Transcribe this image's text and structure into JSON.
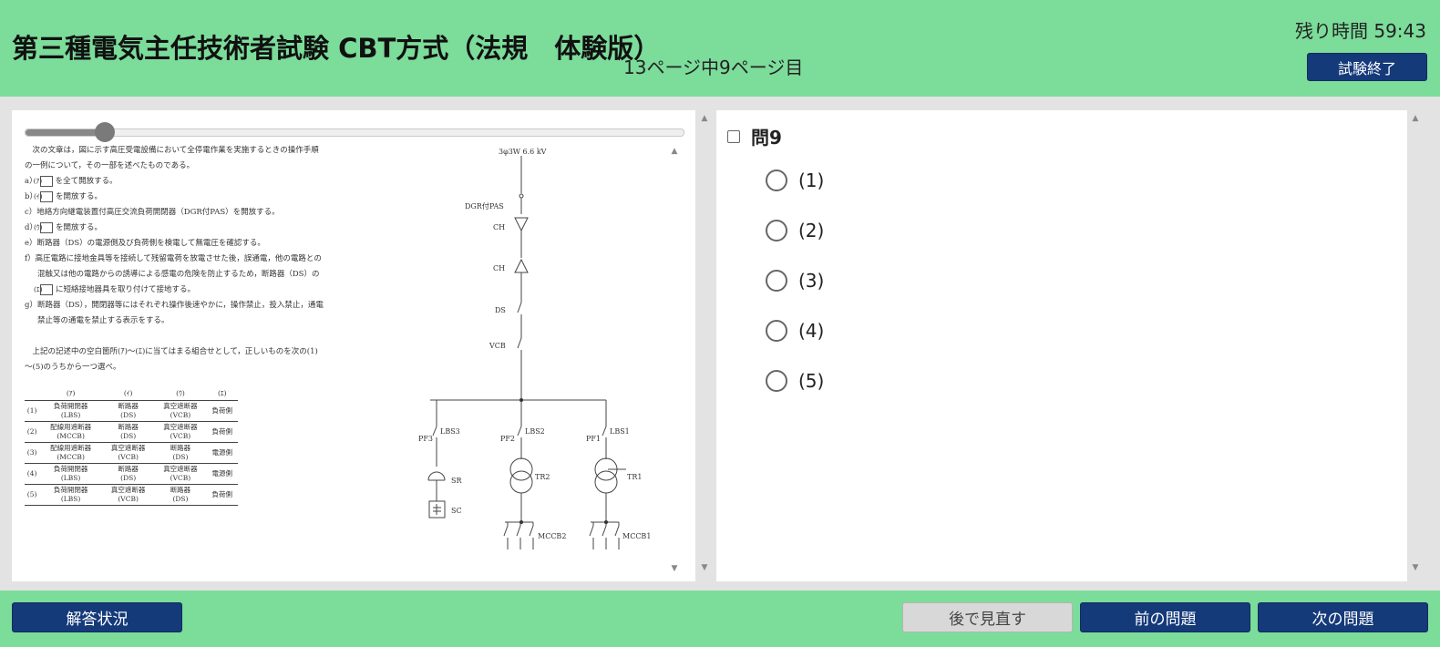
{
  "header": {
    "title": "第三種電気主任技術者試験 CBT方式（法規　体験版）",
    "page_indicator": "13ページ中9ページ目",
    "timer": "残り時間 59:43",
    "end_button": "試験終了"
  },
  "document": {
    "slider_fraction": 0.12,
    "text_lines": [
      "　次の文章は，図に示す高圧受電設備において全停電作業を実施するときの操作手順の一例について，その一部を述べたものである。"
    ],
    "items": [
      {
        "prefix": "a）",
        "blank": "(ｱ)",
        "text": "を全て開放する。"
      },
      {
        "prefix": "b）",
        "blank": "(ｲ)",
        "text": "を開放する。"
      },
      {
        "prefix": "c）",
        "blank": "",
        "text": "地絡方向継電装置付高圧交流負荷開閉器（DGR付PAS）を開放する。"
      },
      {
        "prefix": "d）",
        "blank": "(ｳ)",
        "text": "を開放する。"
      },
      {
        "prefix": "e）",
        "blank": "",
        "text": "断路器（DS）の電源側及び負荷側を検電して無電圧を確認する。"
      },
      {
        "prefix": "f）",
        "blank": "",
        "text": "高圧電路に接地金具等を接続して残留電荷を放電させた後，誤通電，他の電路との混触又は他の電路からの誘導による感電の危険を防止するため，断路器（DS）の"
      },
      {
        "prefix": "g）",
        "blank": "",
        "text": "断路器（DS），開閉器等にはそれぞれ操作後速やかに，操作禁止，投入禁止，通電禁止等の通電を禁止する表示をする。"
      }
    ],
    "f_blank": "(ｴ)",
    "f_tail": "に短絡接地器具を取り付けて接地する。",
    "question": "　上記の記述中の空白箇所(ｱ)～(ｴ)に当てはまる組合せとして，正しいものを次の(1)～(5)のうちから一つ選べ。",
    "table_headers": [
      "",
      "(ｱ)",
      "(ｲ)",
      "(ｳ)",
      "(ｴ)"
    ],
    "table_rows": [
      [
        "(1)",
        "負荷開閉器\n(LBS)",
        "断路器\n(DS)",
        "真空遮断器\n(VCB)",
        "負荷側"
      ],
      [
        "(2)",
        "配線用遮断器\n(MCCB)",
        "断路器\n(DS)",
        "真空遮断器\n(VCB)",
        "負荷側"
      ],
      [
        "(3)",
        "配線用遮断器\n(MCCB)",
        "真空遮断器\n(VCB)",
        "断路器\n(DS)",
        "電源側"
      ],
      [
        "(4)",
        "負荷開閉器\n(LBS)",
        "断路器\n(DS)",
        "真空遮断器\n(VCB)",
        "電源側"
      ],
      [
        "(5)",
        "負荷開閉器\n(LBS)",
        "真空遮断器\n(VCB)",
        "断路器\n(DS)",
        "負荷側"
      ]
    ],
    "diagram_labels": {
      "source": "3φ3W 6.6 kV",
      "pas": "DGR付PAS",
      "ch1": "CH",
      "ch2": "CH",
      "ds": "DS",
      "vcb": "VCB",
      "pf3": "PF3",
      "lbs3": "LBS3",
      "pf2": "PF2",
      "lbs2": "LBS2",
      "pf1": "PF1",
      "lbs1": "LBS1",
      "sr": "SR",
      "sc": "SC",
      "tr2": "TR2",
      "tr1": "TR1",
      "mccb2": "MCCB2",
      "mccb1": "MCCB1"
    }
  },
  "question_panel": {
    "label": "問9",
    "options": [
      "(1)",
      "(2)",
      "(3)",
      "(4)",
      "(5)"
    ]
  },
  "footer": {
    "status_button": "解答状況",
    "review_button": "後で見直す",
    "prev_button": "前の問題",
    "next_button": "次の問題"
  },
  "colors": {
    "header_green": "#7cdc9a",
    "button_navy": "#153a7a",
    "review_gray": "#d8d8d8"
  },
  "icons": {
    "scroll_up": "▲",
    "scroll_down": "▼"
  }
}
